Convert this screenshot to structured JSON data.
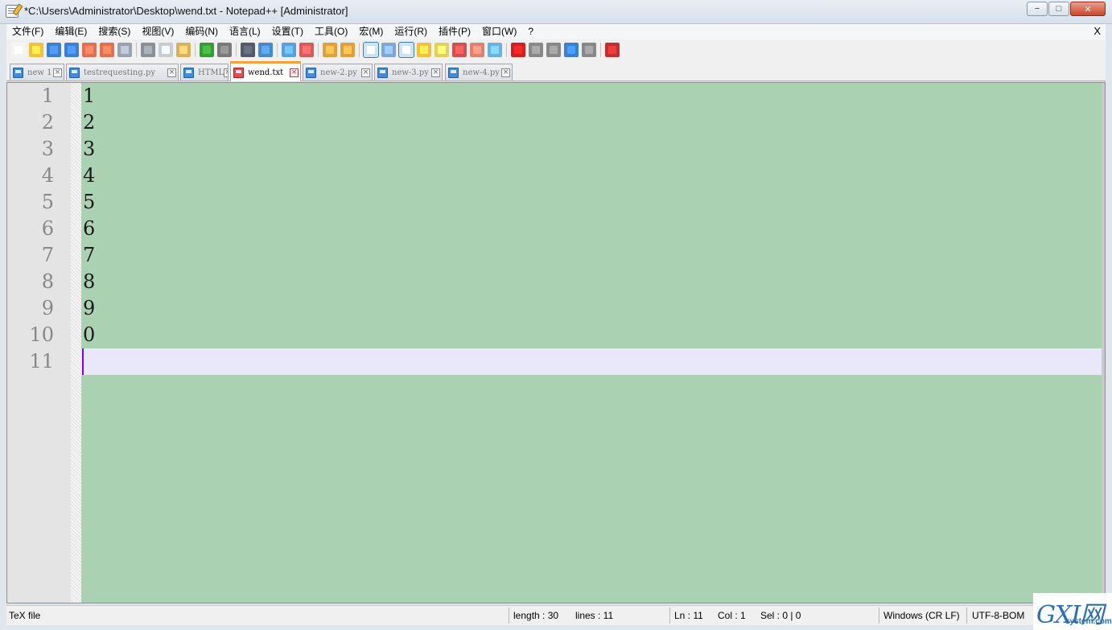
{
  "window": {
    "title": "*C:\\Users\\Administrator\\Desktop\\wend.txt - Notepad++ [Administrator]",
    "minimize_glyph": "−",
    "maximize_glyph": "□",
    "close_glyph": "✕"
  },
  "menu": {
    "items": [
      "文件(F)",
      "编辑(E)",
      "搜索(S)",
      "视图(V)",
      "编码(N)",
      "语言(L)",
      "设置(T)",
      "工具(O)",
      "宏(M)",
      "运行(R)",
      "插件(P)",
      "窗口(W)",
      "?"
    ],
    "close_label": "X"
  },
  "toolbar": {
    "icons": [
      {
        "name": "new-file-icon",
        "color": "#f4f4f4"
      },
      {
        "name": "open-file-icon",
        "color": "#f0c040"
      },
      {
        "name": "save-icon",
        "color": "#3f7fd0"
      },
      {
        "name": "save-all-icon",
        "color": "#3f7fd0"
      },
      {
        "name": "close-file-icon",
        "color": "#e07050"
      },
      {
        "name": "close-all-icon",
        "color": "#e07050"
      },
      {
        "name": "print-icon",
        "color": "#9aa3ad"
      },
      "sep",
      {
        "name": "cut-icon",
        "color": "#8a8f96"
      },
      {
        "name": "copy-icon",
        "color": "#c8cdd4"
      },
      {
        "name": "paste-icon",
        "color": "#d9b060"
      },
      "sep",
      {
        "name": "undo-icon",
        "color": "#3a9a3a"
      },
      {
        "name": "redo-icon",
        "color": "#7a7a7a"
      },
      "sep",
      {
        "name": "find-icon",
        "color": "#555b66"
      },
      {
        "name": "replace-icon",
        "color": "#4b88c8"
      },
      "sep",
      {
        "name": "zoom-in-icon",
        "color": "#5aa0d8"
      },
      {
        "name": "zoom-out-icon",
        "color": "#d85a5a"
      },
      "sep",
      {
        "name": "sync-vertical-icon",
        "color": "#e0a040"
      },
      {
        "name": "sync-horizontal-icon",
        "color": "#e0a040"
      },
      "sep",
      {
        "name": "word-wrap-icon",
        "color": "#5a6f8a",
        "active": true
      },
      {
        "name": "show-all-chars-icon",
        "color": "#7fa6d6"
      },
      {
        "name": "indent-guide-icon",
        "color": "#3a6fc0",
        "active": true
      },
      {
        "name": "user-language-icon",
        "color": "#f0c040"
      },
      {
        "name": "doc-map-icon",
        "color": "#e0d060"
      },
      {
        "name": "function-list-icon",
        "color": "#d05050"
      },
      {
        "name": "folder-workspace-icon",
        "color": "#e08070"
      },
      {
        "name": "monitor-icon",
        "color": "#6ab0e0"
      },
      "sep",
      {
        "name": "record-macro-icon",
        "color": "#d02020"
      },
      {
        "name": "stop-macro-icon",
        "color": "#888888"
      },
      {
        "name": "play-macro-icon",
        "color": "#888888"
      },
      {
        "name": "run-macro-multiple-icon",
        "color": "#3a7fd0"
      },
      {
        "name": "save-macro-icon",
        "color": "#888888"
      },
      "sep",
      {
        "name": "spell-check-icon",
        "color": "#c03030"
      }
    ]
  },
  "tabs": [
    {
      "label": "new 1",
      "active": false
    },
    {
      "label": "testrequesting.py",
      "active": false
    },
    {
      "label": "HTML",
      "active": false
    },
    {
      "label": "wend.txt",
      "active": true
    },
    {
      "label": "new-2.py",
      "active": false
    },
    {
      "label": "new-3.py",
      "active": false
    },
    {
      "label": "new-4.py",
      "active": false
    }
  ],
  "editor": {
    "lines": [
      {
        "number": "1",
        "text": "1"
      },
      {
        "number": "2",
        "text": "2"
      },
      {
        "number": "3",
        "text": "3"
      },
      {
        "number": "4",
        "text": "4"
      },
      {
        "number": "5",
        "text": "5"
      },
      {
        "number": "6",
        "text": "6"
      },
      {
        "number": "7",
        "text": "7"
      },
      {
        "number": "8",
        "text": "8"
      },
      {
        "number": "9",
        "text": "9"
      },
      {
        "number": "10",
        "text": "0"
      },
      {
        "number": "11",
        "text": ""
      }
    ],
    "current_line": 11,
    "background_color": "#a9d1b2",
    "current_line_color": "#e8e8fa",
    "caret_color": "#8000ff"
  },
  "status": {
    "file_type": "TeX file",
    "length": "length : 30",
    "lines": "lines : 11",
    "ln": "Ln : 11",
    "col": "Col : 1",
    "sel": "Sel : 0 | 0",
    "eol": "Windows (CR LF)",
    "encoding": "UTF-8-BOM"
  },
  "watermark": {
    "main": "GXI网",
    "sub": "system.com"
  }
}
